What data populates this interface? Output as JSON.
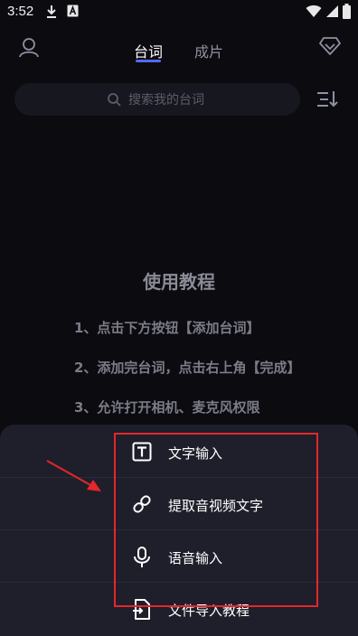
{
  "status_bar": {
    "time": "3:52"
  },
  "header": {
    "tabs": [
      {
        "label": "台词",
        "active": true
      },
      {
        "label": "成片",
        "active": false
      }
    ],
    "accent_color": "#4f6dff"
  },
  "search": {
    "placeholder": "搜索我的台词",
    "value": ""
  },
  "tutorial": {
    "title": "使用教程",
    "steps": [
      "1、点击下方按钮【添加台词】",
      "2、添加完台词，点击右上角【完成】",
      "3、允许打开相机、麦克风权限"
    ]
  },
  "sheet": {
    "items": [
      {
        "label": "文字输入",
        "icon": "text-input-icon"
      },
      {
        "label": "提取音视频文字",
        "icon": "link-icon"
      },
      {
        "label": "语音输入",
        "icon": "microphone-icon"
      },
      {
        "label": "文件导入教程",
        "icon": "file-import-icon"
      }
    ]
  },
  "annotation": {
    "color": "#e6262b"
  }
}
